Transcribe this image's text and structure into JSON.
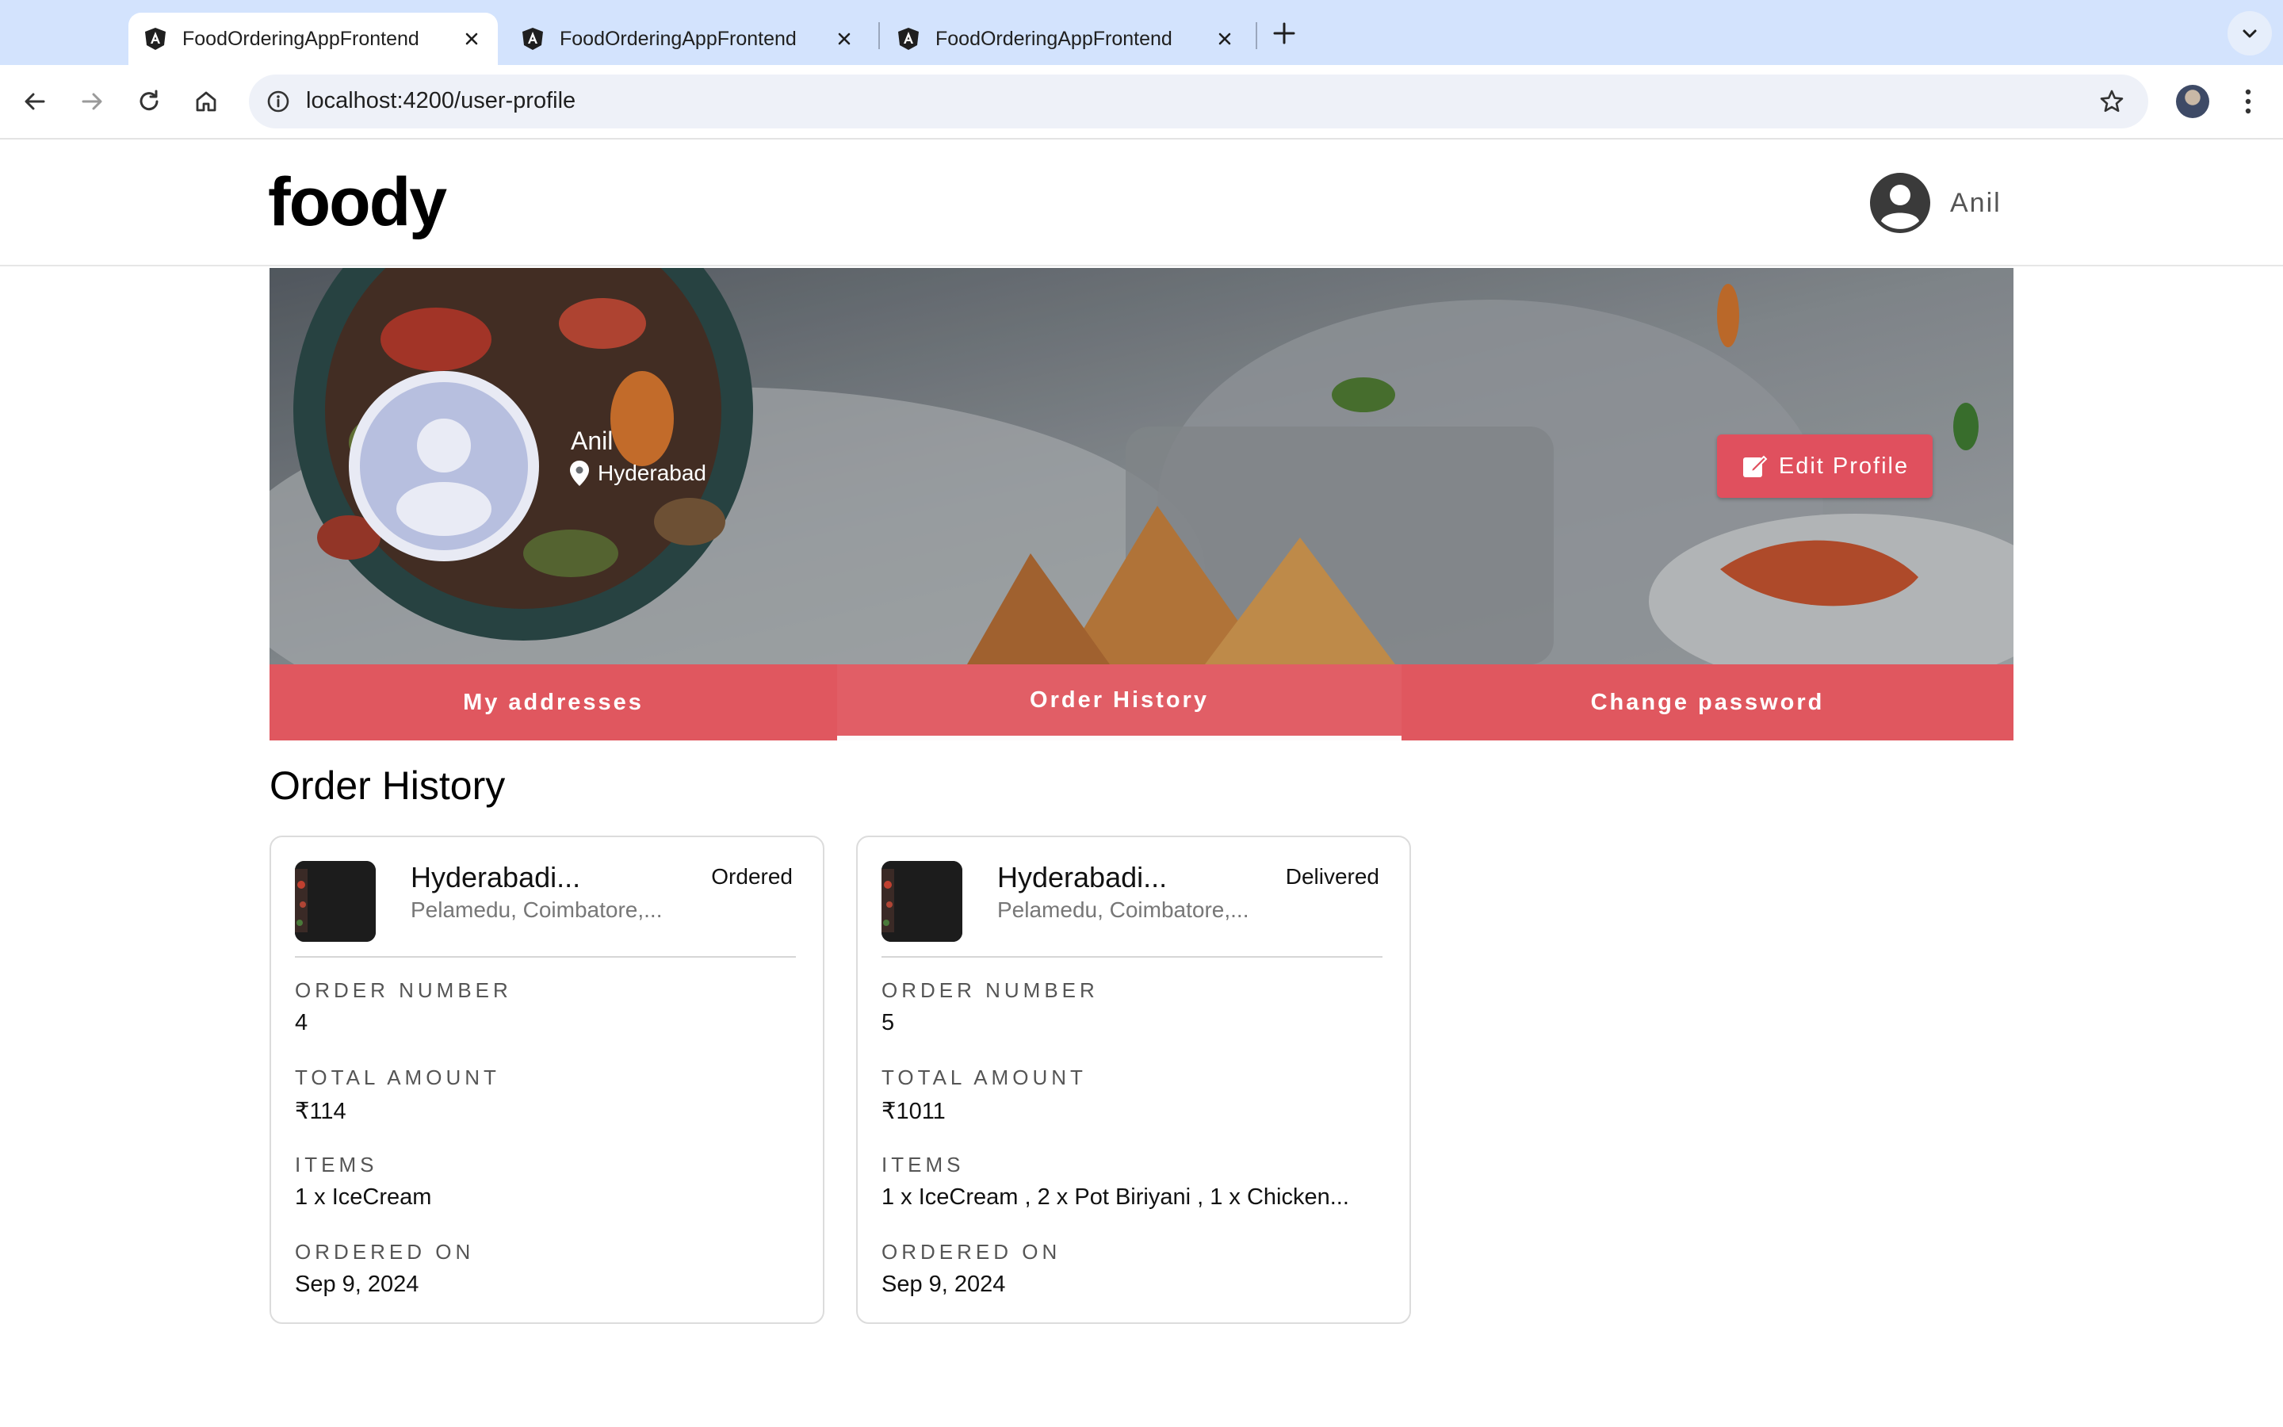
{
  "browser": {
    "tabs": [
      {
        "title": "FoodOrderingAppFrontend",
        "active": true
      },
      {
        "title": "FoodOrderingAppFrontend",
        "active": false
      },
      {
        "title": "FoodOrderingAppFrontend",
        "active": false
      }
    ],
    "url": "localhost:4200/user-profile"
  },
  "header": {
    "logo": "foody",
    "username": "Anil"
  },
  "profile": {
    "name": "Anil",
    "location": "Hyderabad",
    "edit_label": "Edit Profile"
  },
  "profile_tabs": [
    {
      "label": "My addresses",
      "active": false
    },
    {
      "label": "Order History",
      "active": true
    },
    {
      "label": "Change password",
      "active": false
    }
  ],
  "section_title": "Order History",
  "field_labels": {
    "order_number": "ORDER NUMBER",
    "total_amount": "TOTAL AMOUNT",
    "items": "ITEMS",
    "ordered_on": "ORDERED ON"
  },
  "orders": [
    {
      "restaurant": "Hyderabadi...",
      "address": "Pelamedu, Coimbatore,...",
      "status": "Ordered",
      "order_number": "4",
      "total_amount": "₹114",
      "items": "1 x IceCream",
      "ordered_on": "Sep 9, 2024"
    },
    {
      "restaurant": "Hyderabadi...",
      "address": "Pelamedu, Coimbatore,...",
      "status": "Delivered",
      "order_number": "5",
      "total_amount": "₹1011",
      "items": "1 x IceCream , 2 x Pot Biriyani , 1 x Chicken...",
      "ordered_on": "Sep 9, 2024"
    }
  ],
  "colors": {
    "accent": "#e0575f",
    "tabstrip": "#d3e3fd"
  }
}
